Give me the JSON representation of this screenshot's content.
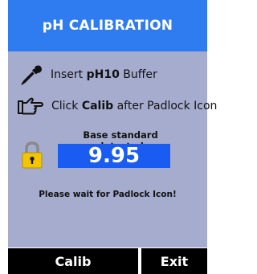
{
  "header": {
    "title": "pH CALIBRATION"
  },
  "instructions": {
    "step1_prefix": "Insert ",
    "step1_bold": "pH10",
    "step1_suffix": " Buffer",
    "step2_prefix": "Click ",
    "step2_bold": "Calib",
    "step2_suffix": " after Padlock Icon"
  },
  "reading": {
    "label": "Base standard detected",
    "value": "9.95"
  },
  "status": {
    "wait_text": "Please wait for Padlock Icon!"
  },
  "buttons": {
    "calib_label": "Calib",
    "exit_label": "Exit"
  },
  "icons": {
    "dropper": "dropper-icon",
    "pointer": "pointing-hand-icon",
    "lock": "padlock-icon"
  },
  "colors": {
    "header_bg": "#2f7bf0",
    "panel_bg": "#a6acce",
    "value_bg": "#1a5cf2",
    "button_bg": "#000000",
    "lock_yellow": "#f2c500"
  }
}
